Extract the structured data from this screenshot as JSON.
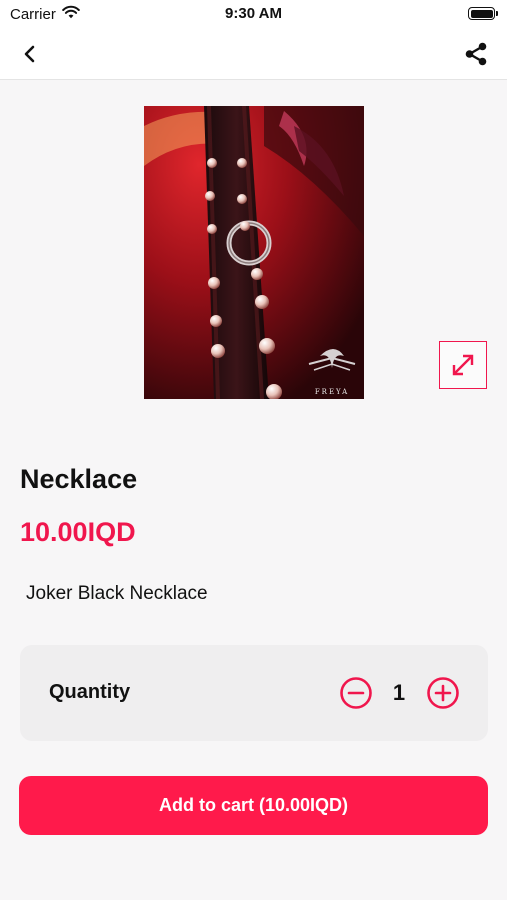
{
  "status_bar": {
    "carrier": "Carrier",
    "time": "9:30 AM",
    "icons": [
      "wifi-icon",
      "battery-icon"
    ]
  },
  "nav": {
    "icons": [
      "chevron-left-icon",
      "share-icon"
    ]
  },
  "product": {
    "image_watermark": "FREYA",
    "title": "Necklace",
    "price": "10.00IQD",
    "description": "Joker Black Necklace",
    "expand_icon": "expand-icon"
  },
  "quantity": {
    "label": "Quantity",
    "value": "1",
    "icons": [
      "minus-circle-icon",
      "plus-circle-icon"
    ]
  },
  "cart": {
    "button_label": "Add to cart (10.00IQD)"
  },
  "colors": {
    "accent": "#f0164d",
    "button": "#ff1a4b",
    "background": "#f7f6f7"
  }
}
